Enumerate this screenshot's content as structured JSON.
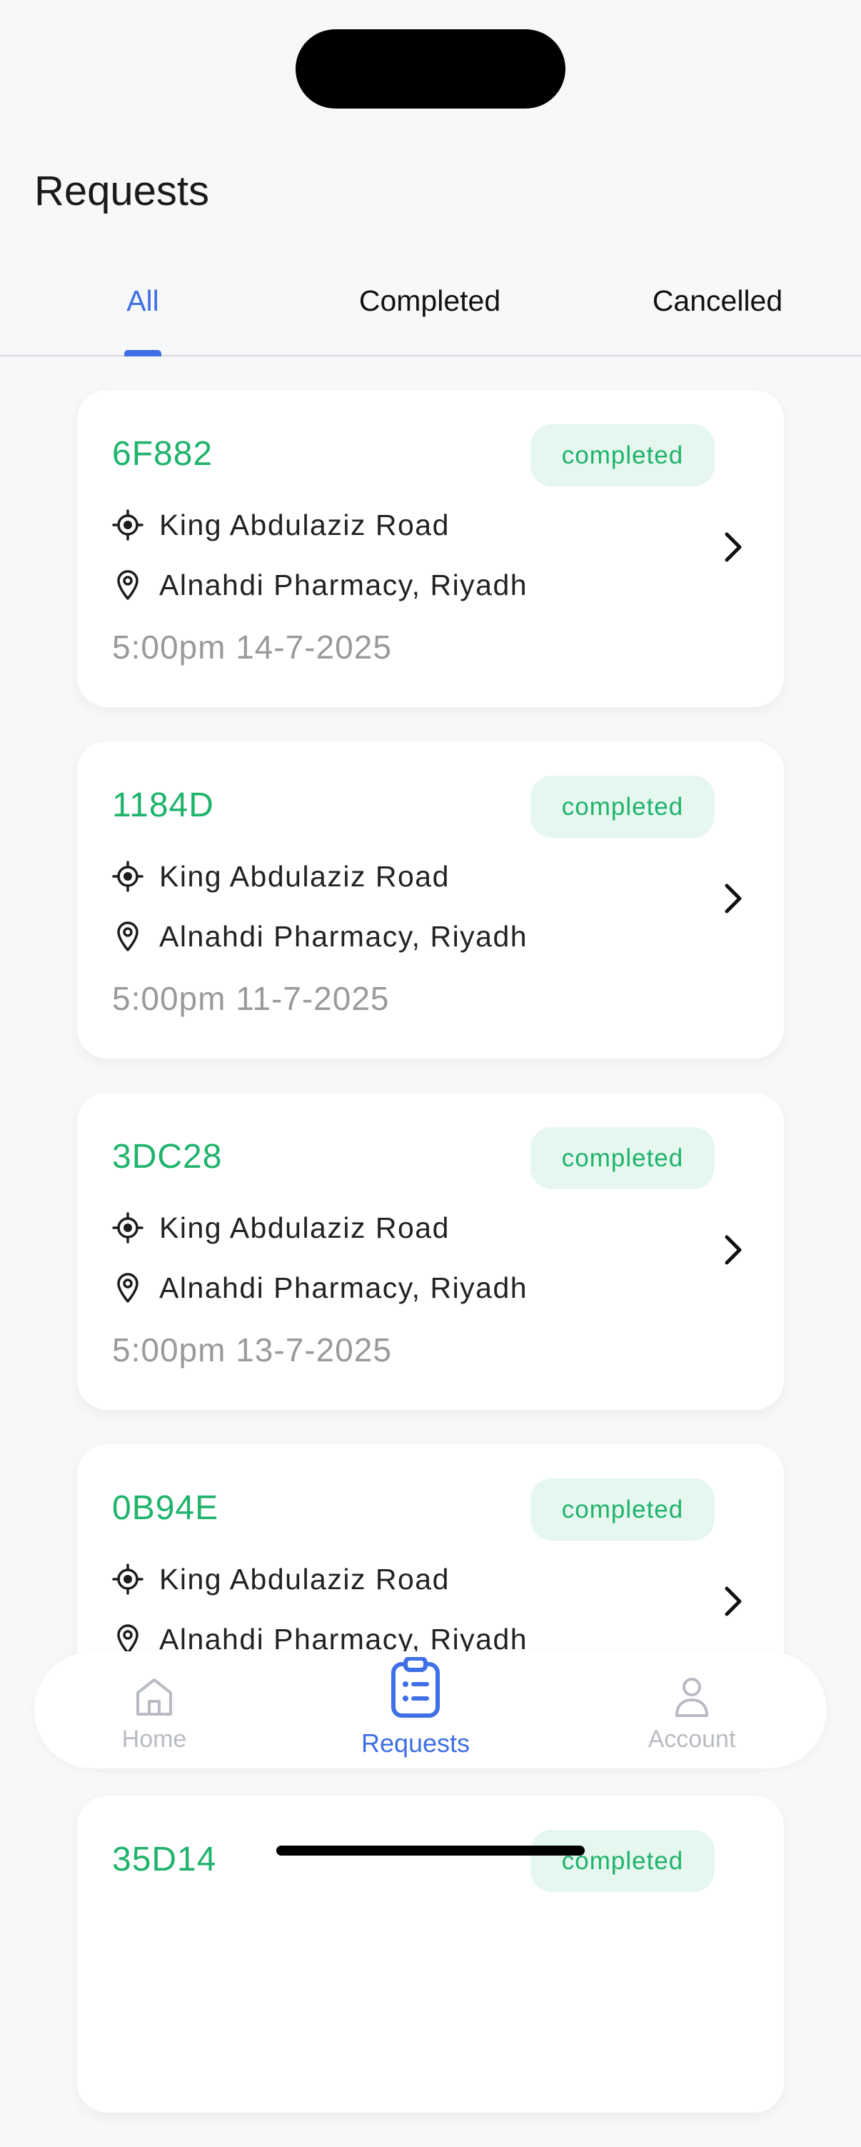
{
  "header": {
    "title": "Requests"
  },
  "tabs": [
    {
      "label": "All",
      "active": true
    },
    {
      "label": "Completed",
      "active": false
    },
    {
      "label": "Cancelled",
      "active": false
    }
  ],
  "requests": [
    {
      "id": "6F882",
      "status": "completed",
      "pickup": "King Abdulaziz Road",
      "dropoff": "Alnahdi Pharmacy, Riyadh",
      "time": "5:00pm 14-7-2025"
    },
    {
      "id": "1184D",
      "status": "completed",
      "pickup": "King Abdulaziz Road",
      "dropoff": "Alnahdi Pharmacy, Riyadh",
      "time": "5:00pm 11-7-2025"
    },
    {
      "id": "3DC28",
      "status": "completed",
      "pickup": "King Abdulaziz Road",
      "dropoff": "Alnahdi Pharmacy, Riyadh",
      "time": "5:00pm 13-7-2025"
    },
    {
      "id": "0B94E",
      "status": "completed",
      "pickup": "King Abdulaziz Road",
      "dropoff": "Alnahdi Pharmacy, Riyadh",
      "time": ""
    },
    {
      "id": "35D14",
      "status": "completed",
      "pickup": "",
      "dropoff": "",
      "time": ""
    }
  ],
  "bottom_nav": {
    "items": [
      {
        "label": "Home",
        "icon": "home-icon",
        "active": false
      },
      {
        "label": "Requests",
        "icon": "clipboard-list-icon",
        "active": true
      },
      {
        "label": "Account",
        "icon": "user-icon",
        "active": false
      }
    ]
  },
  "colors": {
    "accent": "#3f6fe4",
    "status_green": "#1fb36b",
    "status_bg": "#e5f7ee",
    "muted": "#9a9a9a",
    "background": "#f7f8fa"
  }
}
